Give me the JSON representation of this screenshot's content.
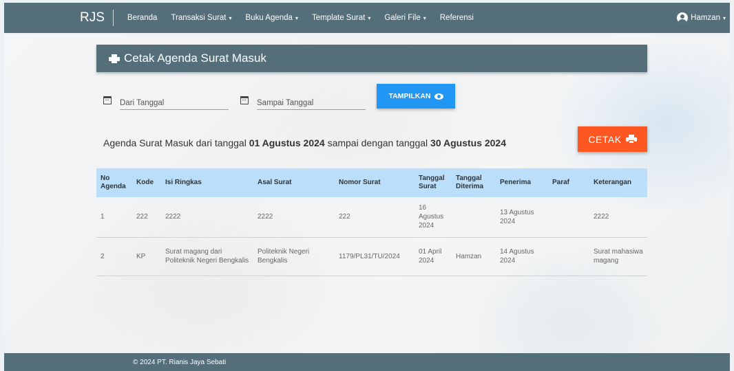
{
  "navbar": {
    "brand": "RJS",
    "items": [
      {
        "label": "Beranda",
        "dropdown": false
      },
      {
        "label": "Transaksi Surat",
        "dropdown": true
      },
      {
        "label": "Buku Agenda",
        "dropdown": true
      },
      {
        "label": "Template Surat",
        "dropdown": true
      },
      {
        "label": "Galeri File",
        "dropdown": true
      },
      {
        "label": "Referensi",
        "dropdown": false
      }
    ],
    "user": "Hamzan",
    "caret": "▾"
  },
  "panel": {
    "title": "Cetak Agenda Surat Masuk"
  },
  "filter": {
    "from_placeholder": "Dari Tanggal",
    "to_placeholder": "Sampai Tanggal",
    "show_label": "TAMPILKAN"
  },
  "caption": {
    "prefix": "Agenda Surat Masuk dari tanggal ",
    "from": "01 Agustus 2024",
    "middle": " sampai dengan tanggal ",
    "to": "30 Agustus 2024"
  },
  "print_label": "CETAK",
  "table": {
    "headers": [
      "No Agenda",
      "Kode",
      "Isi Ringkas",
      "Asal Surat",
      "Nomor Surat",
      "Tanggal Surat",
      "Tanggal Diterima",
      "Penerima",
      "Paraf",
      "Keterangan"
    ],
    "rows": [
      [
        "1",
        "222",
        "2222",
        "2222",
        "222",
        "16 Agustus 2024",
        "",
        "13 Agustus 2024",
        "",
        "2222"
      ],
      [
        "2",
        "KP",
        "Surat magang dari Politeknik Negeri Bengkalis",
        "Politeknik Negeri Bengkalis",
        "1179/PL31/TU/2024",
        "01 April 2024",
        "Hamzan",
        "14 Agustus 2024",
        "",
        "Surat mahasiwa magang"
      ]
    ]
  },
  "footer": {
    "text": "© 2024 PT. Rianis Jaya Sebati"
  },
  "colors": {
    "navbar": "#546e7a",
    "primary_button": "#2196f3",
    "print_button": "#ff5722",
    "table_header": "#bbdefb"
  }
}
